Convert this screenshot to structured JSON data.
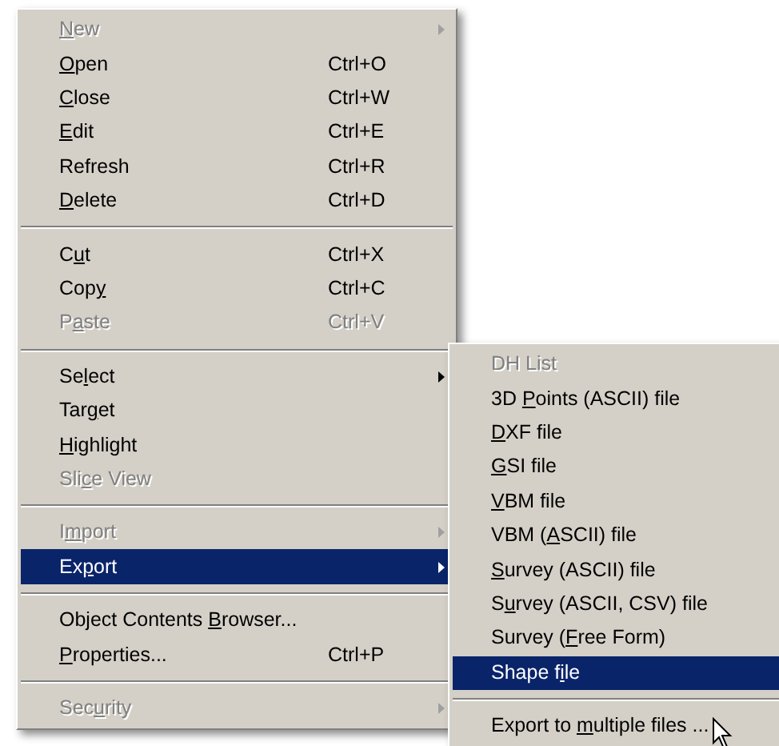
{
  "menu": {
    "items": [
      {
        "kind": "item",
        "label": {
          "key": "N",
          "after": "ew"
        },
        "disabled": true,
        "selected": false,
        "submenu": true
      },
      {
        "kind": "item",
        "label": {
          "key": "O",
          "after": "pen"
        },
        "shortcut": "Ctrl+O",
        "disabled": false,
        "selected": false,
        "submenu": false
      },
      {
        "kind": "item",
        "label": {
          "key": "C",
          "after": "lose"
        },
        "shortcut": "Ctrl+W",
        "disabled": false,
        "selected": false,
        "submenu": false
      },
      {
        "kind": "item",
        "label": {
          "key": "E",
          "after": "dit"
        },
        "shortcut": "Ctrl+E",
        "disabled": false,
        "selected": false,
        "submenu": false
      },
      {
        "kind": "item",
        "label": {
          "before": "Refresh"
        },
        "shortcut": "Ctrl+R",
        "disabled": false,
        "selected": false,
        "submenu": false
      },
      {
        "kind": "item",
        "label": {
          "key": "D",
          "after": "elete"
        },
        "shortcut": "Ctrl+D",
        "disabled": false,
        "selected": false,
        "submenu": false
      },
      {
        "kind": "separator"
      },
      {
        "kind": "item",
        "label": {
          "before": "C",
          "key": "u",
          "after": "t"
        },
        "shortcut": "Ctrl+X",
        "disabled": false,
        "selected": false,
        "submenu": false
      },
      {
        "kind": "item",
        "label": {
          "before": "Cop",
          "key": "y"
        },
        "shortcut": "Ctrl+C",
        "disabled": false,
        "selected": false,
        "submenu": false
      },
      {
        "kind": "item",
        "label": {
          "before": "P",
          "key": "a",
          "after": "ste"
        },
        "shortcut": "Ctrl+V",
        "disabled": true,
        "selected": false,
        "submenu": false
      },
      {
        "kind": "separator"
      },
      {
        "kind": "item",
        "label": {
          "before": "Se",
          "key": "l",
          "after": "ect"
        },
        "disabled": false,
        "selected": false,
        "submenu": true
      },
      {
        "kind": "item",
        "label": {
          "before": "Tar",
          "key": "g",
          "after": "et"
        },
        "disabled": false,
        "selected": false,
        "submenu": false
      },
      {
        "kind": "item",
        "label": {
          "key": "H",
          "after": "ighlight"
        },
        "disabled": false,
        "selected": false,
        "submenu": false
      },
      {
        "kind": "item",
        "label": {
          "before": "Sli",
          "key": "c",
          "after": "e View"
        },
        "disabled": true,
        "selected": false,
        "submenu": false
      },
      {
        "kind": "separator"
      },
      {
        "kind": "item",
        "label": {
          "before": "I",
          "key": "m",
          "after": "port"
        },
        "disabled": true,
        "selected": false,
        "submenu": true
      },
      {
        "kind": "item",
        "label": {
          "before": "Ex",
          "key": "p",
          "after": "ort"
        },
        "disabled": false,
        "selected": true,
        "submenu": true
      },
      {
        "kind": "separator"
      },
      {
        "kind": "item",
        "label": {
          "before": "Object Contents ",
          "key": "B",
          "after": "rowser..."
        },
        "disabled": false,
        "selected": false,
        "submenu": false
      },
      {
        "kind": "item",
        "label": {
          "key": "P",
          "after": "roperties..."
        },
        "shortcut": "Ctrl+P",
        "disabled": false,
        "selected": false,
        "submenu": false
      },
      {
        "kind": "separator"
      },
      {
        "kind": "item",
        "label": {
          "before": "Sec",
          "key": "u",
          "after": "rity"
        },
        "disabled": true,
        "selected": false,
        "submenu": true
      }
    ]
  },
  "submenu": {
    "items": [
      {
        "kind": "item",
        "label": {
          "before": "DH List"
        },
        "disabled": true,
        "selected": false
      },
      {
        "kind": "item",
        "label": {
          "before": "3D ",
          "key": "P",
          "after": "oints (ASCII) file"
        },
        "disabled": false,
        "selected": false
      },
      {
        "kind": "item",
        "label": {
          "key": "D",
          "after": "XF file"
        },
        "disabled": false,
        "selected": false
      },
      {
        "kind": "item",
        "label": {
          "key": "G",
          "after": "SI file"
        },
        "disabled": false,
        "selected": false
      },
      {
        "kind": "item",
        "label": {
          "key": "V",
          "after": "BM file"
        },
        "disabled": false,
        "selected": false
      },
      {
        "kind": "item",
        "label": {
          "before": "VBM (",
          "key": "A",
          "after": "SCII) file"
        },
        "disabled": false,
        "selected": false
      },
      {
        "kind": "item",
        "label": {
          "key": "S",
          "after": "urvey (ASCII) file"
        },
        "disabled": false,
        "selected": false
      },
      {
        "kind": "item",
        "label": {
          "before": "S",
          "key": "u",
          "after": "rvey (ASCII, CSV) file"
        },
        "disabled": false,
        "selected": false
      },
      {
        "kind": "item",
        "label": {
          "before": "Survey (",
          "key": "F",
          "after": "ree Form)"
        },
        "disabled": false,
        "selected": false
      },
      {
        "kind": "item",
        "label": {
          "before": "Shape f",
          "key": "i",
          "after": "le"
        },
        "disabled": false,
        "selected": true
      },
      {
        "kind": "separator"
      },
      {
        "kind": "item",
        "label": {
          "before": "Export to ",
          "key": "m",
          "after": "ultiple files ..."
        },
        "disabled": false,
        "selected": false
      }
    ]
  }
}
